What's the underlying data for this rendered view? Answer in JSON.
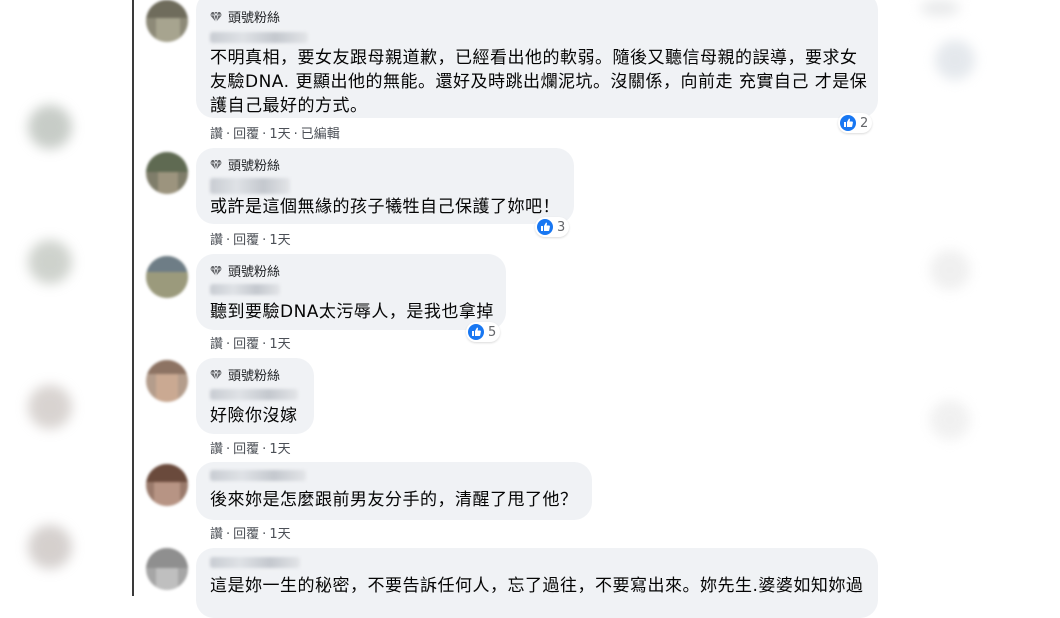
{
  "comments": [
    {
      "badge": "頭號粉絲",
      "lines": [
        "不明真相，要女友跟母親道歉，已經看出他的軟弱。隨後又聽信母親的誤導，要求女",
        "友驗DNA. 更顯出他的無能。還好及時跳出爛泥坑。沒關係，向前走 充實自己 才是保",
        "護自己最好的方式。"
      ],
      "actions": [
        "讚",
        "回覆",
        "1天",
        "已編輯"
      ],
      "reactions": "2"
    },
    {
      "badge": "頭號粉絲",
      "lines": [
        "或許是這個無緣的孩子犧牲自己保護了妳吧！"
      ],
      "actions": [
        "讚",
        "回覆",
        "1天"
      ],
      "reactions": "3"
    },
    {
      "badge": "頭號粉絲",
      "lines": [
        "聽到要驗DNA太污辱人，是我也拿掉"
      ],
      "actions": [
        "讚",
        "回覆",
        "1天"
      ],
      "reactions": "5"
    },
    {
      "badge": "頭號粉絲",
      "lines": [
        "好險你沒嫁"
      ],
      "actions": [
        "讚",
        "回覆",
        "1天"
      ]
    },
    {
      "lines": [
        "後來妳是怎麼跟前男友分手的，清醒了甩了他？"
      ],
      "actions": [
        "讚",
        "回覆",
        "1天"
      ]
    },
    {
      "lines": [
        "這是妳一生的秘密，不要告訴任何人，忘了過往，不要寫出來。妳先生.婆婆如知妳過"
      ]
    }
  ],
  "icons": {
    "badge": "diamond-icon",
    "reaction": "like-icon"
  },
  "colors": {
    "bubble": "#f0f2f5",
    "like_blue": "#1877f2",
    "text": "#050505",
    "meta": "#4b4f56"
  }
}
